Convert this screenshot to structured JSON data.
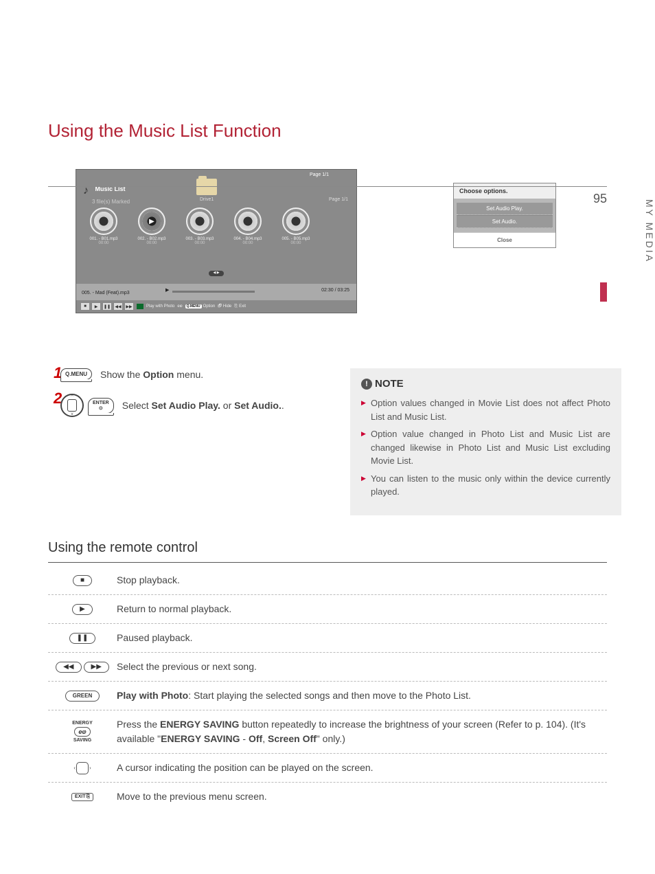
{
  "title": "Using the Music List Function",
  "side_tab": "MY MEDIA",
  "page_number": "95",
  "screenshot": {
    "page_top": "Page 1/1",
    "title": "Music List",
    "subtitle": "3 file(s) Marked",
    "drive": "Drive1",
    "page_inner": "Page 1/1",
    "tracks": [
      {
        "name": "001. - B01.mp3",
        "dur": "00:00"
      },
      {
        "name": "002. - B02.mp3",
        "dur": "00:00"
      },
      {
        "name": "003. - B03.mp3",
        "dur": "00:00"
      },
      {
        "name": "004. - B04.mp3",
        "dur": "00:00"
      },
      {
        "name": "005. - B05.mp3",
        "dur": "00:00"
      }
    ],
    "now_playing": "005. - Mad (Feat).mp3",
    "time": "02:30 / 03:25",
    "footer": {
      "play_with_photo": "Play with Photo",
      "option": "Option",
      "hide": "Hide",
      "exit": "Exit",
      "qmenu": "Q.MENU"
    }
  },
  "options_box": {
    "head": "Choose options.",
    "items": [
      "Set Audio Play.",
      "Set Audio."
    ],
    "close": "Close"
  },
  "steps": {
    "s1_btn": "Q.MENU",
    "s1_pre": "Show the ",
    "s1_bold": "Option",
    "s1_post": " menu.",
    "s2_btn": "ENTER",
    "s2_pre": "Select ",
    "s2_b1": "Set Audio Play.",
    "s2_mid": " or ",
    "s2_b2": "Set Audio.",
    "s2_post": "."
  },
  "note": {
    "title": "NOTE",
    "items": [
      "Option values changed in Movie List does not affect Photo List and Music List.",
      "Option value changed in Photo List and Music List are changed likewise in Photo List and Music List excluding Movie List.",
      "You can listen to the music only within the device currently played."
    ]
  },
  "subsection": "Using the remote control",
  "remote_table": {
    "r1": "Stop playback.",
    "r2": "Return to normal playback.",
    "r3": "Paused playback.",
    "r4": "Select the previous or next song.",
    "r5_b": "Play with Photo",
    "r5_t": ": Start playing the selected songs and then move to the Photo List.",
    "r6_a": "Press the ",
    "r6_b1": "ENERGY SAVING",
    "r6_c": " button repeatedly to increase the brightness of your screen (Refer to p. 104). (It's available \"",
    "r6_b2": "ENERGY SAVING",
    "r6_d": " - ",
    "r6_b3": "Off",
    "r6_e": ", ",
    "r6_b4": "Screen Off",
    "r6_f": "\" only.)",
    "r7": "A cursor indicating the position can be played on the screen.",
    "r8": "Move to the previous menu screen.",
    "green": "GREEN",
    "energy": "ENERGY",
    "saving": "SAVING",
    "exit": "EXIT"
  }
}
